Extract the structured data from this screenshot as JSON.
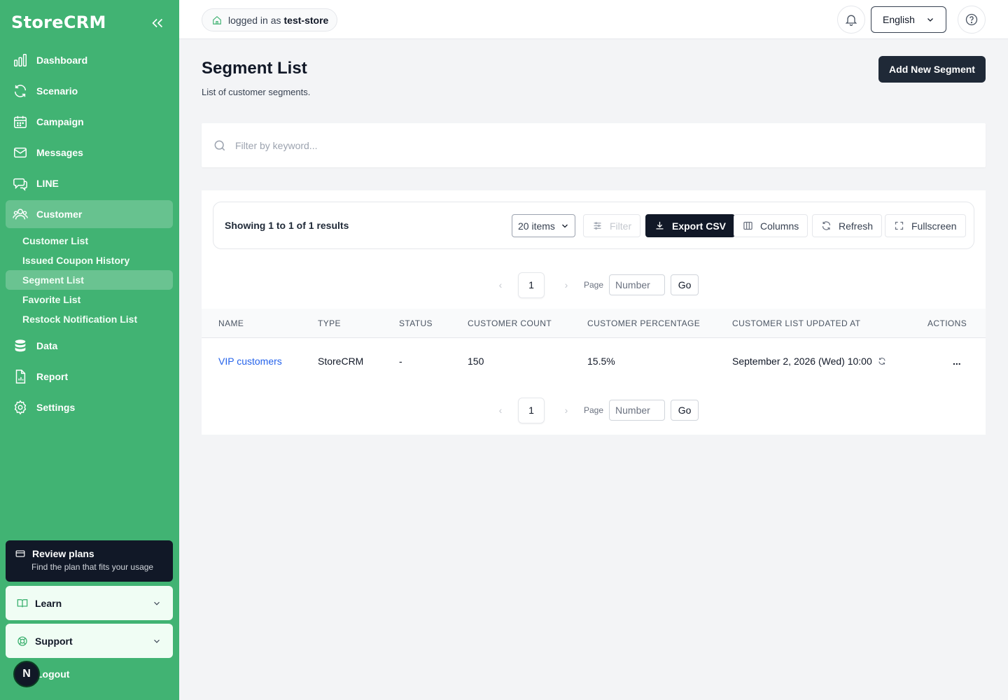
{
  "brand": "StoreCRM",
  "sidebar": {
    "nav": [
      {
        "label": "Dashboard",
        "icon": "chart-bar-icon"
      },
      {
        "label": "Scenario",
        "icon": "refresh-icon"
      },
      {
        "label": "Campaign",
        "icon": "calendar-icon"
      },
      {
        "label": "Messages",
        "icon": "mail-icon"
      },
      {
        "label": "LINE",
        "icon": "chat-icon"
      },
      {
        "label": "Customer",
        "icon": "users-icon",
        "active": true
      },
      {
        "label": "Data",
        "icon": "database-icon"
      },
      {
        "label": "Report",
        "icon": "report-icon"
      },
      {
        "label": "Settings",
        "icon": "gear-icon"
      }
    ],
    "customer_sub": [
      {
        "label": "Customer List"
      },
      {
        "label": "Issued Coupon History"
      },
      {
        "label": "Segment List",
        "active": true
      },
      {
        "label": "Favorite List"
      },
      {
        "label": "Restock Notification List"
      }
    ],
    "plan_card": {
      "title": "Review plans",
      "subtitle": "Find the plan that fits your usage"
    },
    "learn_label": "Learn",
    "support_label": "Support",
    "logout_label": "Logout",
    "avatar_initial": "N"
  },
  "topbar": {
    "logged_in_prefix": "logged in as",
    "store_name": "test-store",
    "language": "English"
  },
  "page": {
    "title": "Segment List",
    "subtitle": "List of customer segments.",
    "add_button": "Add New Segment",
    "search_placeholder": "Filter by keyword..."
  },
  "toolbar": {
    "showing": "Showing 1 to 1 of 1 results",
    "items_per_page": "20 items",
    "filter": "Filter",
    "export": "Export CSV",
    "columns": "Columns",
    "refresh": "Refresh",
    "fullscreen": "Fullscreen"
  },
  "pagination": {
    "current": "1",
    "page_label": "Page",
    "input_placeholder": "Number",
    "go": "Go"
  },
  "table": {
    "headers": [
      "NAME",
      "TYPE",
      "STATUS",
      "CUSTOMER COUNT",
      "CUSTOMER PERCENTAGE",
      "CUSTOMER LIST UPDATED AT",
      "ACTIONS"
    ],
    "rows": [
      {
        "name": "VIP customers",
        "type": "StoreCRM",
        "status": "-",
        "count": "150",
        "percentage": "15.5%",
        "updated_at": "September 2, 2026 (Wed) 10:00",
        "actions": "..."
      }
    ]
  },
  "colors": {
    "sidebar": "#41b373",
    "dark": "#111827",
    "link": "#2563eb"
  }
}
